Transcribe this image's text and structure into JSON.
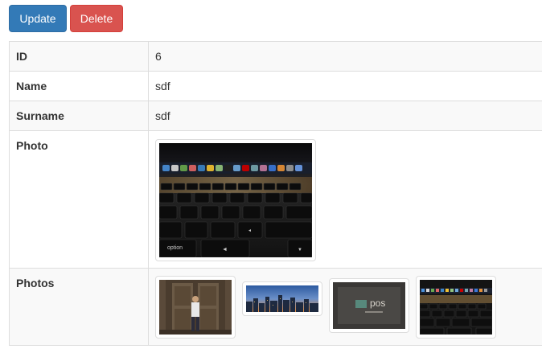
{
  "toolbar": {
    "update_label": "Update",
    "delete_label": "Delete"
  },
  "record": {
    "rows": [
      {
        "label": "ID",
        "value": "6"
      },
      {
        "label": "Name",
        "value": "sdf"
      },
      {
        "label": "Surname",
        "value": "sdf"
      },
      {
        "label": "Photo",
        "value": ""
      },
      {
        "label": "Photos",
        "value": ""
      }
    ]
  },
  "colors": {
    "primary": "#337ab7",
    "danger": "#d9534f",
    "border": "#dddddd",
    "stripe": "#f9f9f9"
  },
  "images": {
    "photo": "keyboard-photo",
    "photos": [
      "person-door-photo",
      "city-skyline-photo",
      "dark-logo-photo",
      "keyboard-photo"
    ],
    "logo_text": "pos"
  }
}
